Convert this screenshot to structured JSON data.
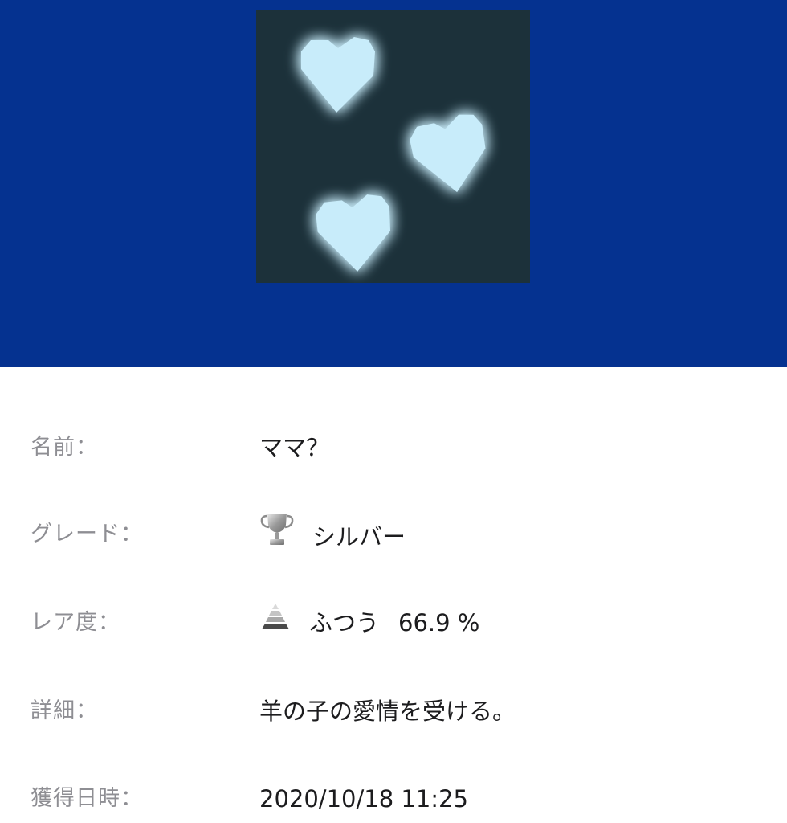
{
  "trophy": {
    "image_icon": "glowing-hearts-icon",
    "colors": {
      "header_bg": "#053290",
      "image_bg": "#1c313a",
      "heart_fill": "#c8ecfa"
    }
  },
  "details": {
    "name": {
      "label": "名前：",
      "value": "ママ？"
    },
    "grade": {
      "label": "グレード：",
      "icon": "silver-trophy-icon",
      "value": "シルバー"
    },
    "rarity": {
      "label": "レア度：",
      "icon": "rarity-pyramid-icon",
      "value": "ふつう",
      "percent": "66.9 %"
    },
    "description": {
      "label": "詳細：",
      "value": "羊の子の愛情を受ける。"
    },
    "earned": {
      "label": "獲得日時：",
      "value": "2020/10/18 11:25"
    }
  }
}
